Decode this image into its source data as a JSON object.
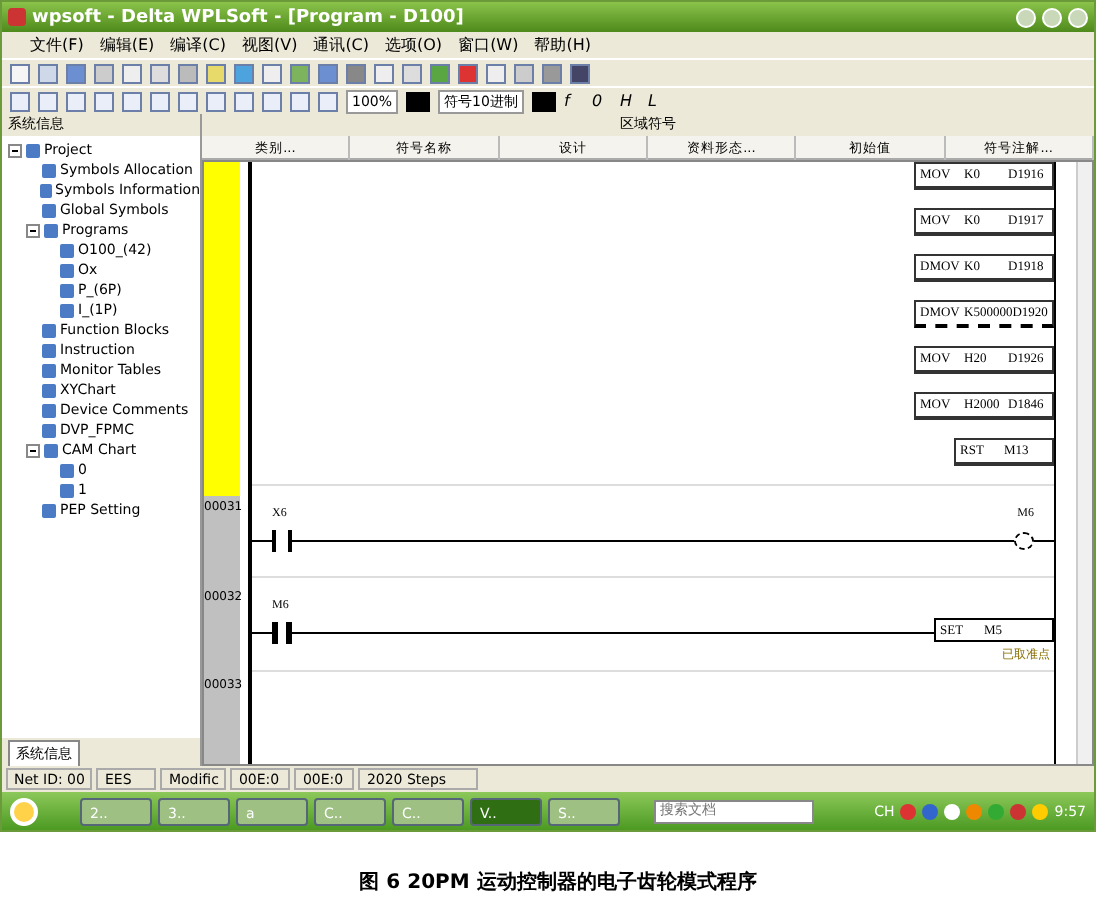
{
  "window": {
    "title": "wpsoft - Delta WPLSoft - [Program - D100]"
  },
  "menu": [
    "文件(F)",
    "编辑(E)",
    "编译(C)",
    "视图(V)",
    "通讯(C)",
    "选项(O)",
    "窗口(W)",
    "帮助(H)"
  ],
  "toolbar": {
    "zoom": "100%",
    "mode": "符号10进制",
    "labels": [
      "f",
      "0",
      "H",
      "L"
    ]
  },
  "sidebar": {
    "title": "系统信息",
    "tab": "系统信息",
    "tree": [
      {
        "label": "Project",
        "expanded": true,
        "children": [
          {
            "label": "Symbols Allocation"
          },
          {
            "label": "Symbols Information"
          },
          {
            "label": "Global Symbols"
          },
          {
            "label": "Programs",
            "expanded": true,
            "children": [
              {
                "label": "O100_(42)"
              },
              {
                "label": "Ox"
              },
              {
                "label": "P_(6P)"
              },
              {
                "label": "I_(1P)"
              }
            ]
          },
          {
            "label": "Function Blocks"
          },
          {
            "label": "Instruction"
          },
          {
            "label": "Monitor Tables"
          },
          {
            "label": "XYChart"
          },
          {
            "label": "Device Comments"
          },
          {
            "label": "DVP_FPMC"
          },
          {
            "label": "CAM Chart",
            "expanded": true,
            "children": [
              {
                "label": "0"
              },
              {
                "label": "1"
              }
            ]
          },
          {
            "label": "PEP Setting"
          }
        ]
      }
    ]
  },
  "symbol_table": {
    "title": "区域符号",
    "columns": [
      "类别...",
      "符号名称",
      "设计",
      "资料形态...",
      "初始值",
      "符号注解..."
    ]
  },
  "ladder": {
    "instructions": [
      {
        "op": "MOV",
        "a": "K0",
        "b": "D1916",
        "selected": false
      },
      {
        "op": "MOV",
        "a": "K0",
        "b": "D1917",
        "selected": false
      },
      {
        "op": "DMOV",
        "a": "K0",
        "b": "D1918",
        "selected": false
      },
      {
        "op": "DMOV",
        "a": "K500000",
        "b": "D1920",
        "selected": true
      },
      {
        "op": "MOV",
        "a": "H20",
        "b": "D1926",
        "selected": false
      },
      {
        "op": "MOV",
        "a": "H2000",
        "b": "D1846",
        "selected": false
      },
      {
        "op": "RST",
        "a": "M13",
        "selected": false
      }
    ],
    "rungs": [
      {
        "number": "00031",
        "kind": "coil",
        "contact": {
          "label": "X6",
          "kind": "open"
        },
        "target": "M6"
      },
      {
        "number": "00032",
        "kind": "set",
        "contact": {
          "label": "M6",
          "kind": "pulse"
        },
        "op": "SET",
        "target": "M5",
        "comment": "已取准点"
      },
      {
        "number": "00033"
      }
    ]
  },
  "status_bar": [
    "Net ID: 00",
    "EES",
    "Modific",
    "00E:0",
    "00E:0",
    "2020 Steps"
  ],
  "taskbar": {
    "tasks": [
      {
        "label": "2..",
        "selected": false
      },
      {
        "label": "3..",
        "selected": false
      },
      {
        "label": "a",
        "selected": false
      },
      {
        "label": "C..",
        "selected": false
      },
      {
        "label": "C..",
        "selected": false
      },
      {
        "label": "V..",
        "selected": true
      },
      {
        "label": "S..",
        "selected": false
      }
    ],
    "search": {
      "placeholder": "搜索文档"
    },
    "clock": "CH",
    "time": "9:57"
  },
  "caption": "图 6 20PM 运动控制器的电子齿轮模式程序"
}
